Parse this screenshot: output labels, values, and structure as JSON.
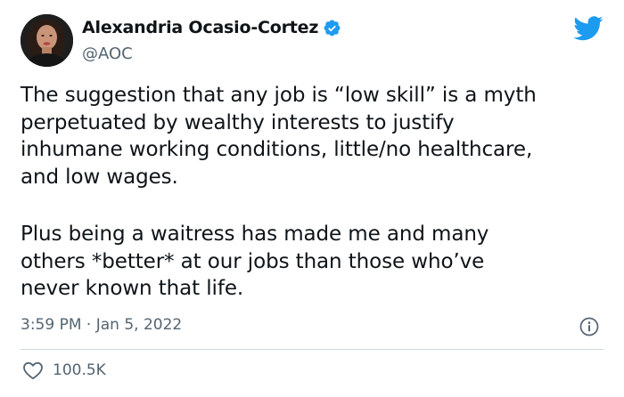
{
  "author": {
    "display_name": "Alexandria Ocasio-Cortez",
    "handle": "@AOC",
    "verified": true
  },
  "tweet": {
    "paragraph_1": "The suggestion that any job is “low skill” is a myth\nperpetuated by wealthy interests to justify\ninhumane working conditions, little/no healthcare,\nand low wages.",
    "paragraph_2": "Plus being a waitress has made me and many\nothers *better* at our jobs than those who’ve\nnever known that life.",
    "timestamp": "3:59 PM · Jan 5, 2022",
    "likes_count": "100.5K"
  },
  "icons": {
    "brand": "twitter-bird-icon",
    "verified": "verified-badge-icon",
    "info": "info-icon",
    "like": "heart-icon"
  },
  "colors": {
    "brand_blue": "#1d9bf0",
    "text_primary": "#0f1419",
    "text_secondary": "#536471"
  }
}
